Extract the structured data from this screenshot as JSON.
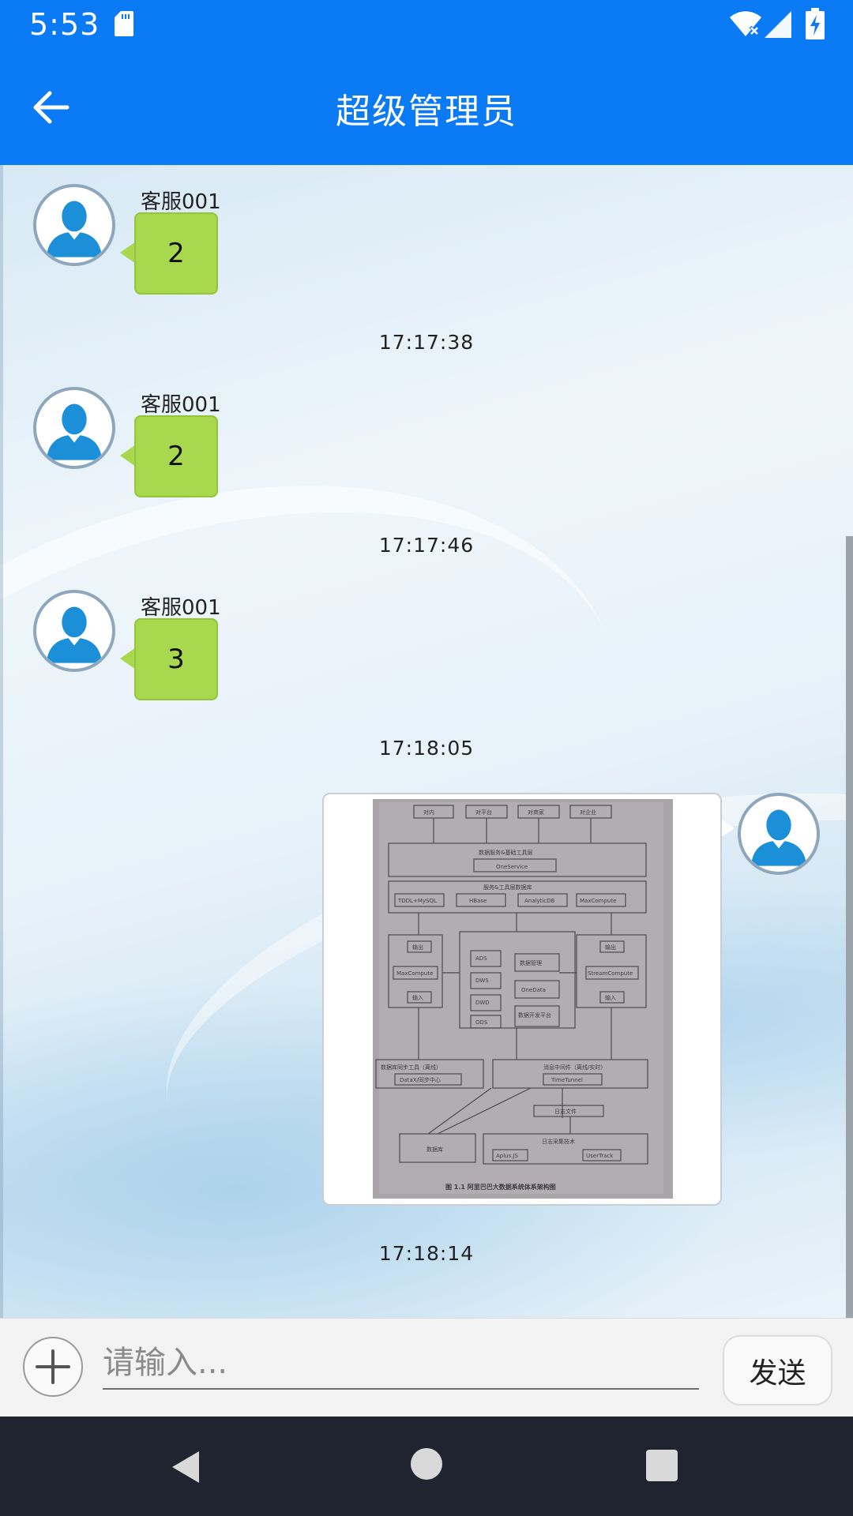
{
  "status_bar": {
    "time": "5:53",
    "icons": [
      "sd-card-icon",
      "wifi-icon",
      "signal-icon",
      "battery-icon"
    ]
  },
  "app_bar": {
    "title": "超级管理员",
    "back_icon": "arrow-left-icon"
  },
  "messages": [
    {
      "sender": "客服001",
      "text": "2",
      "time": "17:17:38"
    },
    {
      "sender": "客服001",
      "text": "2",
      "time": "17:17:46"
    },
    {
      "sender": "客服001",
      "text": "3",
      "time": "17:18:05"
    }
  ],
  "image_message": {
    "caption": "图 1.1 阿里巴巴大数据系统体系架构图",
    "time": "17:18:14",
    "diagram_labels": {
      "top": [
        "对内",
        "对平台",
        "对商家",
        "对企业"
      ],
      "service_layer": "数据服务&基础工具层",
      "one_service": "OneService",
      "storage_layer": "服务&工具层数据库",
      "stores": [
        "TDDL+MySQL",
        "HBase",
        "AnalyticDB",
        "MaxCompute"
      ],
      "compute_left": [
        "输出",
        "MaxCompute",
        "输入"
      ],
      "compute_mid": [
        "ADS",
        "DWS",
        "DWD",
        "ODS",
        "数据管理",
        "OneData",
        "数据开发平台"
      ],
      "compute_right": [
        "输出",
        "StreamCompute",
        "输入"
      ],
      "sync_left": [
        "数据库同步工具（离线）",
        "DataX/同步中心"
      ],
      "sync_right": [
        "消息中间件（离线/实时）",
        "TimeTunnel"
      ],
      "log_file": "日志文件",
      "collect": [
        "数据库",
        "日志采集技术",
        "Aplus.JS",
        "UserTrack"
      ]
    }
  },
  "input_bar": {
    "placeholder": "请输入...",
    "value": "",
    "send_label": "发送",
    "add_icon": "plus-icon"
  },
  "nav_bar": {
    "icons": [
      "back-triangle-icon",
      "home-circle-icon",
      "recents-square-icon"
    ]
  },
  "colors": {
    "primary": "#0a7af5",
    "bubble": "#a8d84d",
    "nav": "#1f2430"
  }
}
